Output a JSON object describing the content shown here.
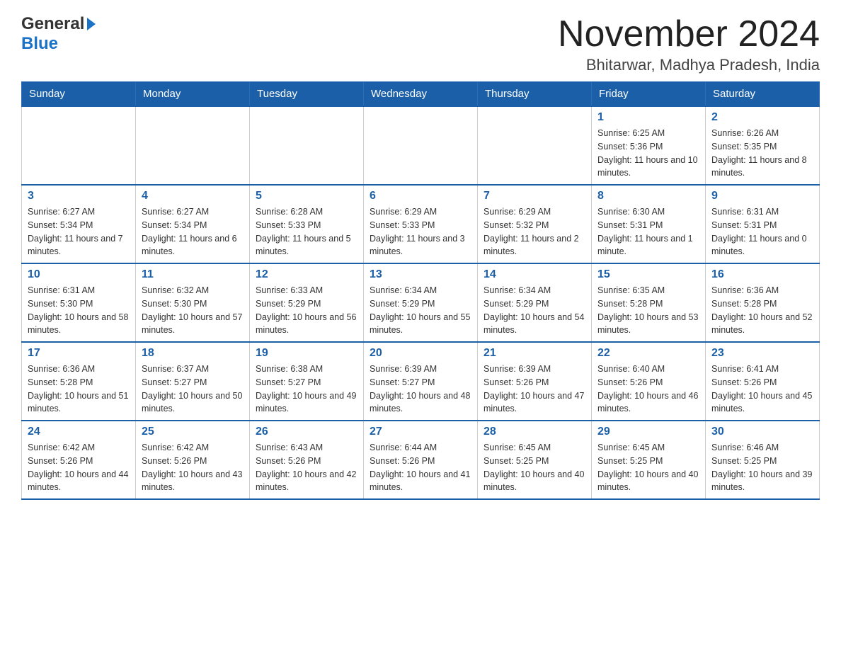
{
  "header": {
    "logo_general": "General",
    "logo_blue": "Blue",
    "month_title": "November 2024",
    "location": "Bhitarwar, Madhya Pradesh, India"
  },
  "weekdays": [
    "Sunday",
    "Monday",
    "Tuesday",
    "Wednesday",
    "Thursday",
    "Friday",
    "Saturday"
  ],
  "weeks": [
    [
      {
        "day": "",
        "sunrise": "",
        "sunset": "",
        "daylight": ""
      },
      {
        "day": "",
        "sunrise": "",
        "sunset": "",
        "daylight": ""
      },
      {
        "day": "",
        "sunrise": "",
        "sunset": "",
        "daylight": ""
      },
      {
        "day": "",
        "sunrise": "",
        "sunset": "",
        "daylight": ""
      },
      {
        "day": "",
        "sunrise": "",
        "sunset": "",
        "daylight": ""
      },
      {
        "day": "1",
        "sunrise": "Sunrise: 6:25 AM",
        "sunset": "Sunset: 5:36 PM",
        "daylight": "Daylight: 11 hours and 10 minutes."
      },
      {
        "day": "2",
        "sunrise": "Sunrise: 6:26 AM",
        "sunset": "Sunset: 5:35 PM",
        "daylight": "Daylight: 11 hours and 8 minutes."
      }
    ],
    [
      {
        "day": "3",
        "sunrise": "Sunrise: 6:27 AM",
        "sunset": "Sunset: 5:34 PM",
        "daylight": "Daylight: 11 hours and 7 minutes."
      },
      {
        "day": "4",
        "sunrise": "Sunrise: 6:27 AM",
        "sunset": "Sunset: 5:34 PM",
        "daylight": "Daylight: 11 hours and 6 minutes."
      },
      {
        "day": "5",
        "sunrise": "Sunrise: 6:28 AM",
        "sunset": "Sunset: 5:33 PM",
        "daylight": "Daylight: 11 hours and 5 minutes."
      },
      {
        "day": "6",
        "sunrise": "Sunrise: 6:29 AM",
        "sunset": "Sunset: 5:33 PM",
        "daylight": "Daylight: 11 hours and 3 minutes."
      },
      {
        "day": "7",
        "sunrise": "Sunrise: 6:29 AM",
        "sunset": "Sunset: 5:32 PM",
        "daylight": "Daylight: 11 hours and 2 minutes."
      },
      {
        "day": "8",
        "sunrise": "Sunrise: 6:30 AM",
        "sunset": "Sunset: 5:31 PM",
        "daylight": "Daylight: 11 hours and 1 minute."
      },
      {
        "day": "9",
        "sunrise": "Sunrise: 6:31 AM",
        "sunset": "Sunset: 5:31 PM",
        "daylight": "Daylight: 11 hours and 0 minutes."
      }
    ],
    [
      {
        "day": "10",
        "sunrise": "Sunrise: 6:31 AM",
        "sunset": "Sunset: 5:30 PM",
        "daylight": "Daylight: 10 hours and 58 minutes."
      },
      {
        "day": "11",
        "sunrise": "Sunrise: 6:32 AM",
        "sunset": "Sunset: 5:30 PM",
        "daylight": "Daylight: 10 hours and 57 minutes."
      },
      {
        "day": "12",
        "sunrise": "Sunrise: 6:33 AM",
        "sunset": "Sunset: 5:29 PM",
        "daylight": "Daylight: 10 hours and 56 minutes."
      },
      {
        "day": "13",
        "sunrise": "Sunrise: 6:34 AM",
        "sunset": "Sunset: 5:29 PM",
        "daylight": "Daylight: 10 hours and 55 minutes."
      },
      {
        "day": "14",
        "sunrise": "Sunrise: 6:34 AM",
        "sunset": "Sunset: 5:29 PM",
        "daylight": "Daylight: 10 hours and 54 minutes."
      },
      {
        "day": "15",
        "sunrise": "Sunrise: 6:35 AM",
        "sunset": "Sunset: 5:28 PM",
        "daylight": "Daylight: 10 hours and 53 minutes."
      },
      {
        "day": "16",
        "sunrise": "Sunrise: 6:36 AM",
        "sunset": "Sunset: 5:28 PM",
        "daylight": "Daylight: 10 hours and 52 minutes."
      }
    ],
    [
      {
        "day": "17",
        "sunrise": "Sunrise: 6:36 AM",
        "sunset": "Sunset: 5:28 PM",
        "daylight": "Daylight: 10 hours and 51 minutes."
      },
      {
        "day": "18",
        "sunrise": "Sunrise: 6:37 AM",
        "sunset": "Sunset: 5:27 PM",
        "daylight": "Daylight: 10 hours and 50 minutes."
      },
      {
        "day": "19",
        "sunrise": "Sunrise: 6:38 AM",
        "sunset": "Sunset: 5:27 PM",
        "daylight": "Daylight: 10 hours and 49 minutes."
      },
      {
        "day": "20",
        "sunrise": "Sunrise: 6:39 AM",
        "sunset": "Sunset: 5:27 PM",
        "daylight": "Daylight: 10 hours and 48 minutes."
      },
      {
        "day": "21",
        "sunrise": "Sunrise: 6:39 AM",
        "sunset": "Sunset: 5:26 PM",
        "daylight": "Daylight: 10 hours and 47 minutes."
      },
      {
        "day": "22",
        "sunrise": "Sunrise: 6:40 AM",
        "sunset": "Sunset: 5:26 PM",
        "daylight": "Daylight: 10 hours and 46 minutes."
      },
      {
        "day": "23",
        "sunrise": "Sunrise: 6:41 AM",
        "sunset": "Sunset: 5:26 PM",
        "daylight": "Daylight: 10 hours and 45 minutes."
      }
    ],
    [
      {
        "day": "24",
        "sunrise": "Sunrise: 6:42 AM",
        "sunset": "Sunset: 5:26 PM",
        "daylight": "Daylight: 10 hours and 44 minutes."
      },
      {
        "day": "25",
        "sunrise": "Sunrise: 6:42 AM",
        "sunset": "Sunset: 5:26 PM",
        "daylight": "Daylight: 10 hours and 43 minutes."
      },
      {
        "day": "26",
        "sunrise": "Sunrise: 6:43 AM",
        "sunset": "Sunset: 5:26 PM",
        "daylight": "Daylight: 10 hours and 42 minutes."
      },
      {
        "day": "27",
        "sunrise": "Sunrise: 6:44 AM",
        "sunset": "Sunset: 5:26 PM",
        "daylight": "Daylight: 10 hours and 41 minutes."
      },
      {
        "day": "28",
        "sunrise": "Sunrise: 6:45 AM",
        "sunset": "Sunset: 5:25 PM",
        "daylight": "Daylight: 10 hours and 40 minutes."
      },
      {
        "day": "29",
        "sunrise": "Sunrise: 6:45 AM",
        "sunset": "Sunset: 5:25 PM",
        "daylight": "Daylight: 10 hours and 40 minutes."
      },
      {
        "day": "30",
        "sunrise": "Sunrise: 6:46 AM",
        "sunset": "Sunset: 5:25 PM",
        "daylight": "Daylight: 10 hours and 39 minutes."
      }
    ]
  ]
}
